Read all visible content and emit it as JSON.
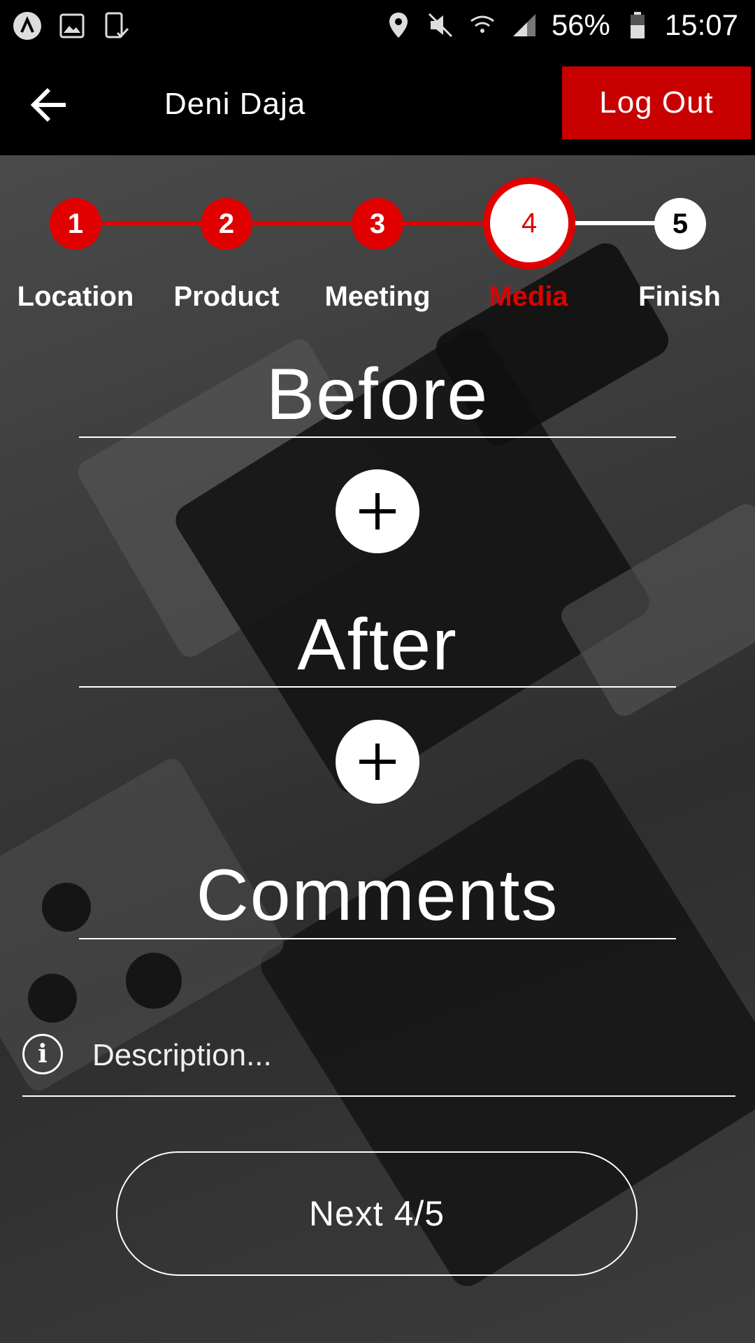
{
  "status_bar": {
    "battery": "56%",
    "time": "15:07",
    "left_icons": [
      "a-logo-icon",
      "image-icon",
      "device-check-icon"
    ],
    "right_icons": [
      "location-icon",
      "mute-icon",
      "wifi-icon",
      "signal-icon",
      "battery-icon"
    ]
  },
  "header": {
    "title": "Deni Daja",
    "logout_label": "Log Out"
  },
  "stepper": {
    "current_step": 4,
    "steps": [
      {
        "number": "1",
        "label": "Location",
        "state": "done"
      },
      {
        "number": "2",
        "label": "Product",
        "state": "done"
      },
      {
        "number": "3",
        "label": "Meeting",
        "state": "done"
      },
      {
        "number": "4",
        "label": "Media",
        "state": "active"
      },
      {
        "number": "5",
        "label": "Finish",
        "state": "pending"
      }
    ]
  },
  "sections": {
    "before": "Before",
    "after": "After",
    "comments": "Comments"
  },
  "description": {
    "placeholder": "Description...",
    "value": ""
  },
  "next_button": "Next 4/5",
  "colors": {
    "accent": "#c80000",
    "step_red": "#e00000",
    "background": "#000000"
  }
}
